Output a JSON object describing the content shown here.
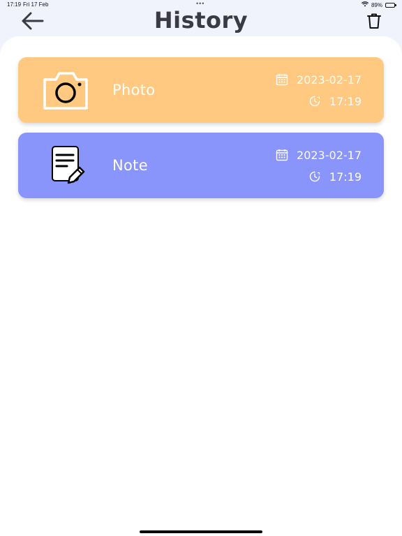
{
  "status_bar": {
    "time": "17:19",
    "date": "Fri 17 Feb",
    "dots": "•••",
    "battery": "89%",
    "battery_level": 0.89
  },
  "header": {
    "title": "History",
    "back_icon": "arrow-left-icon",
    "delete_icon": "trash-icon"
  },
  "colors": {
    "background": "#f1f3fc",
    "photo_card": "#ffc982",
    "note_card": "#8a95fb",
    "title": "#3a3a45"
  },
  "history": [
    {
      "type": "Photo",
      "icon": "camera-icon",
      "date": "2023-02-17",
      "time": "17:19"
    },
    {
      "type": "Note",
      "icon": "note-edit-icon",
      "date": "2023-02-17",
      "time": "17:19"
    }
  ]
}
